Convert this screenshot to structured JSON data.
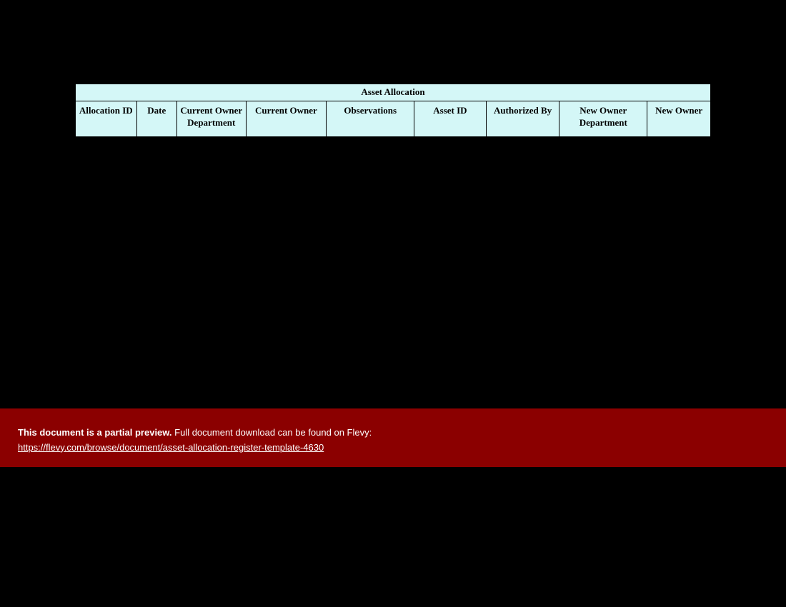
{
  "table": {
    "title": "Asset Allocation",
    "columns": [
      "Allocation ID",
      "Date",
      "Current Owner Department",
      "Current Owner",
      "Observations",
      "Asset ID",
      "Authorized By",
      "New Owner Department",
      "New Owner"
    ]
  },
  "banner": {
    "strong": "This document is a partial preview.",
    "rest": "  Full document download can be found on Flevy:",
    "link": "https://flevy.com/browse/document/asset-allocation-register-template-4630"
  }
}
